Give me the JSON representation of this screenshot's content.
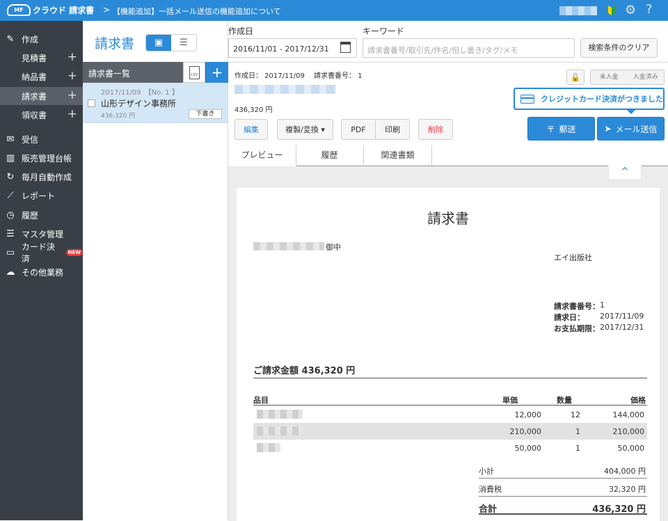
{
  "app": {
    "logo_mf": "MF",
    "logo_text": "クラウド 請求書",
    "breadcrumb_arrow": ">",
    "announcement": "【機能追加】一括メール送信の機能追加について",
    "gear": "⚙",
    "help": "?"
  },
  "sidebar": {
    "create": "作成",
    "sub_items": [
      {
        "label": "見積書",
        "plus": "+"
      },
      {
        "label": "納品書",
        "plus": "+"
      },
      {
        "label": "請求書",
        "plus": "+"
      },
      {
        "label": "領収書",
        "plus": "+"
      }
    ],
    "items": [
      {
        "label": "受信",
        "icon": "✉"
      },
      {
        "label": "販売管理台帳",
        "icon": "▥"
      },
      {
        "label": "毎月自動作成",
        "icon": "↻"
      },
      {
        "label": "レポート",
        "icon": "⟋"
      },
      {
        "label": "履歴",
        "icon": "◷"
      },
      {
        "label": "マスタ管理",
        "icon": "☰"
      },
      {
        "label": "カード決済",
        "icon": "▭",
        "badge": "NEW"
      },
      {
        "label": "その他業務",
        "icon": "☁"
      }
    ]
  },
  "list": {
    "title": "請求書",
    "header": "請求書一覧",
    "csv": "CSV",
    "add": "+",
    "row": {
      "date": "2017/11/09　【No. 1 】",
      "name": "山形デザイン事務所",
      "amount": "436,320 円",
      "status": "下書き"
    }
  },
  "search": {
    "date_label": "作成日",
    "date_value": "2016/11/01 - 2017/12/31",
    "keyword_label": "キーワード",
    "keyword_placeholder": "請求書番号/取引先/件名/但し書き/タグ/メモ",
    "clear": "検索条件のクリア"
  },
  "detail": {
    "meta": "作成日： 2017/11/09　 請求書番号： 1",
    "amount": "436,320 円",
    "status_unpaid": "未入金",
    "status_paid": "入金済み",
    "tooltip": "クレジットカード決済がつきました",
    "buttons": {
      "edit": "編集",
      "copy": "複製/変換 ▾",
      "pdf": "PDF",
      "print": "印刷",
      "delete": "削除",
      "mail": "郵送",
      "email": "メール送信"
    },
    "tabs": [
      "プレビュー",
      "履歴",
      "関連書類"
    ],
    "collapse": "^"
  },
  "invoice": {
    "title": "請求書",
    "to_suffix": "御中",
    "from": "エイ出版社",
    "number_label": "請求書番号：",
    "number": "1",
    "date_label": "請求日：",
    "date": "2017/11/09",
    "due_label": "お支払期限：",
    "due": "2017/12/31",
    "total_label": "ご請求金額 436,320 円",
    "headers": {
      "item": "品目",
      "unit": "単価",
      "qty": "数量",
      "price": "価格"
    },
    "rows": [
      {
        "unit": "12,000",
        "qty": "12",
        "price": "144,000"
      },
      {
        "unit": "210,000",
        "qty": "1",
        "price": "210,000"
      },
      {
        "unit": "50,000",
        "qty": "1",
        "price": "50,000"
      }
    ],
    "subtotal_label": "小計",
    "subtotal": "404,000 円",
    "tax_label": "消費税",
    "tax": "32,320 円",
    "grand_label": "合計",
    "grand": "436,320 円"
  },
  "colors": {
    "primary": "#2b8ad8",
    "sidebar": "#3a3f47",
    "danger": "#e8383d"
  }
}
